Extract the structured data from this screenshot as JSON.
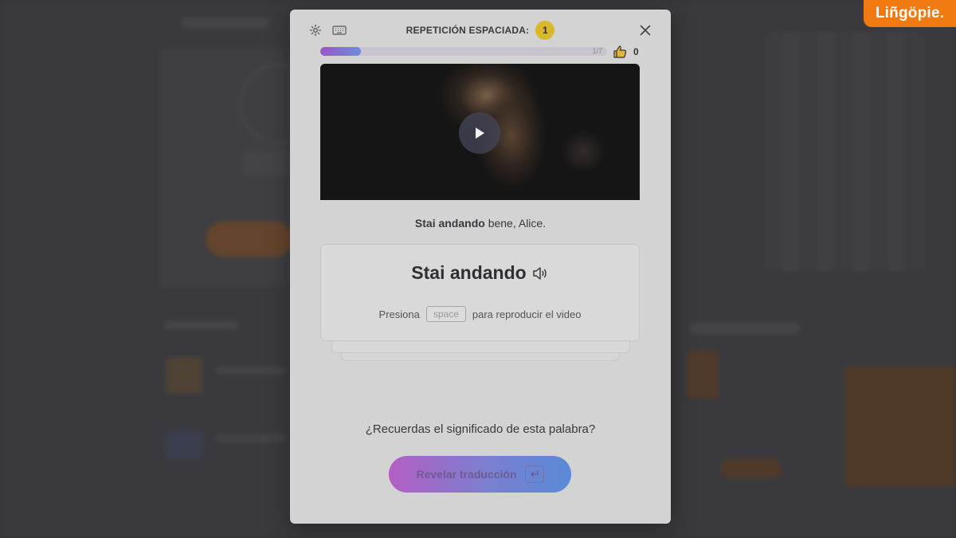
{
  "brand": {
    "name": "Liñgöpie."
  },
  "modal": {
    "title": "REPETICIÓN ESPACIADA:",
    "review_count": "1",
    "progress": {
      "label": "1/7",
      "current": 1,
      "total": 7
    },
    "likes": "0",
    "sentence": {
      "highlight": "Stai andando",
      "rest": " bene, Alice."
    },
    "card": {
      "word": "Stai andando",
      "hint_before": "Presiona",
      "hint_key": "space",
      "hint_after": "para reproducir el video"
    },
    "question": "¿Recuerdas el significado de esta palabra?",
    "reveal_button": "Revelar traducción"
  },
  "colors": {
    "brand": "#f07a10",
    "badge": "#d9b82a",
    "gradient_start": "#b45fc4",
    "gradient_end": "#5a8ad8"
  },
  "icons": [
    "settings-icon",
    "keyboard-icon",
    "close-icon",
    "thumbs-up-icon",
    "play-icon",
    "speaker-icon",
    "enter-icon"
  ]
}
